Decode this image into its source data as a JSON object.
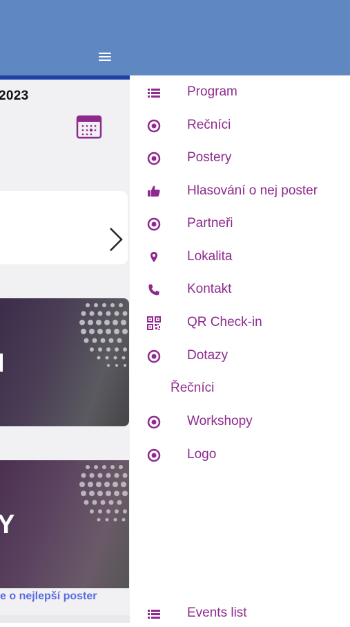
{
  "header": {
    "menu_icon": "hamburger-icon",
    "bg_color": "#5f88c3"
  },
  "left_panel": {
    "date_text": "2023",
    "calendar_icon": "calendar-icon",
    "banner1_text": "I",
    "banner2_text": "Y",
    "poster_link": "e o nejlepší poster"
  },
  "menu": {
    "accent_color": "#8e2a8e",
    "items": [
      {
        "label": "Program",
        "icon": "list-icon"
      },
      {
        "label": "Rečníci",
        "icon": "radio-dot-icon"
      },
      {
        "label": "Postery",
        "icon": "radio-dot-icon"
      },
      {
        "label": "Hlasování o nej poster",
        "icon": "thumbs-up-icon"
      },
      {
        "label": "Partneři",
        "icon": "radio-dot-icon"
      },
      {
        "label": "Lokalita",
        "icon": "map-pin-icon"
      },
      {
        "label": "Kontakt",
        "icon": "phone-icon"
      },
      {
        "label": "QR Check-in",
        "icon": "qr-code-icon"
      },
      {
        "label": "Dotazy",
        "icon": "radio-dot-icon"
      },
      {
        "label": "Řečníci",
        "icon": ""
      },
      {
        "label": "Workshopy",
        "icon": "radio-dot-icon"
      },
      {
        "label": "Logo",
        "icon": "radio-dot-icon"
      }
    ],
    "footer_item": {
      "label": "Events list",
      "icon": "list-icon"
    }
  }
}
